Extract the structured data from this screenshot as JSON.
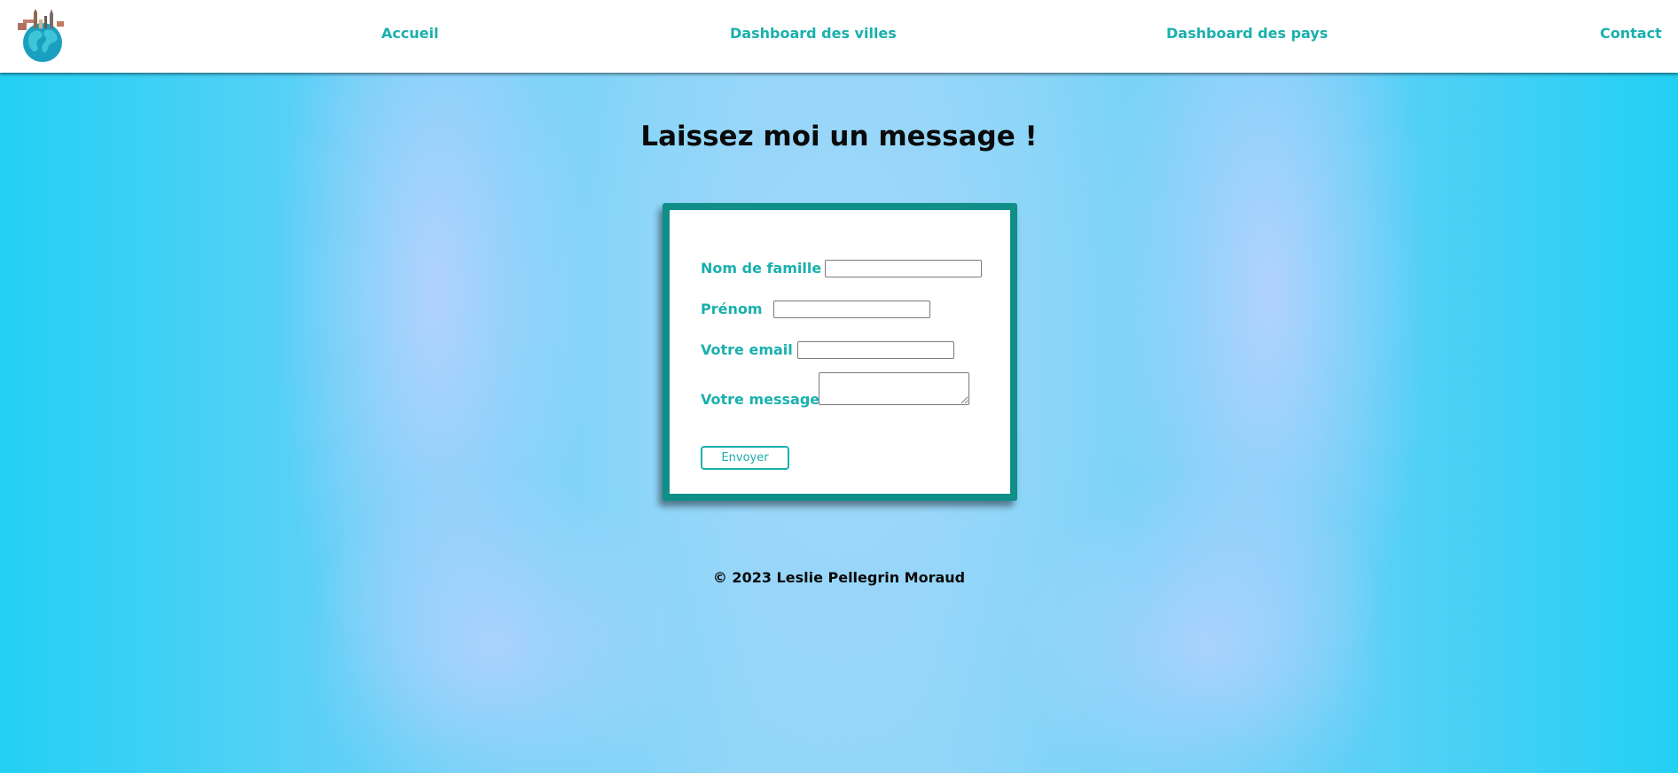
{
  "header": {
    "logo_icon": "globe-with-landmarks-icon",
    "nav": [
      {
        "label": "Accueil"
      },
      {
        "label": "Dashboard des villes"
      },
      {
        "label": "Dashboard des pays"
      },
      {
        "label": "Contact"
      }
    ]
  },
  "main": {
    "title": "Laissez moi un message !"
  },
  "form": {
    "fields": [
      {
        "label": "Nom de famille",
        "value": ""
      },
      {
        "label": "Prénom",
        "value": ""
      },
      {
        "label": "Votre email",
        "value": ""
      },
      {
        "label": "Votre message",
        "value": ""
      }
    ],
    "submit_label": "Envoyer"
  },
  "footer": {
    "text": "© 2023 Leslie Pellegrin Moraud"
  },
  "colors": {
    "accent": "#1ab0ad",
    "card_border": "#0f8f88",
    "background": "#22d0f4"
  }
}
